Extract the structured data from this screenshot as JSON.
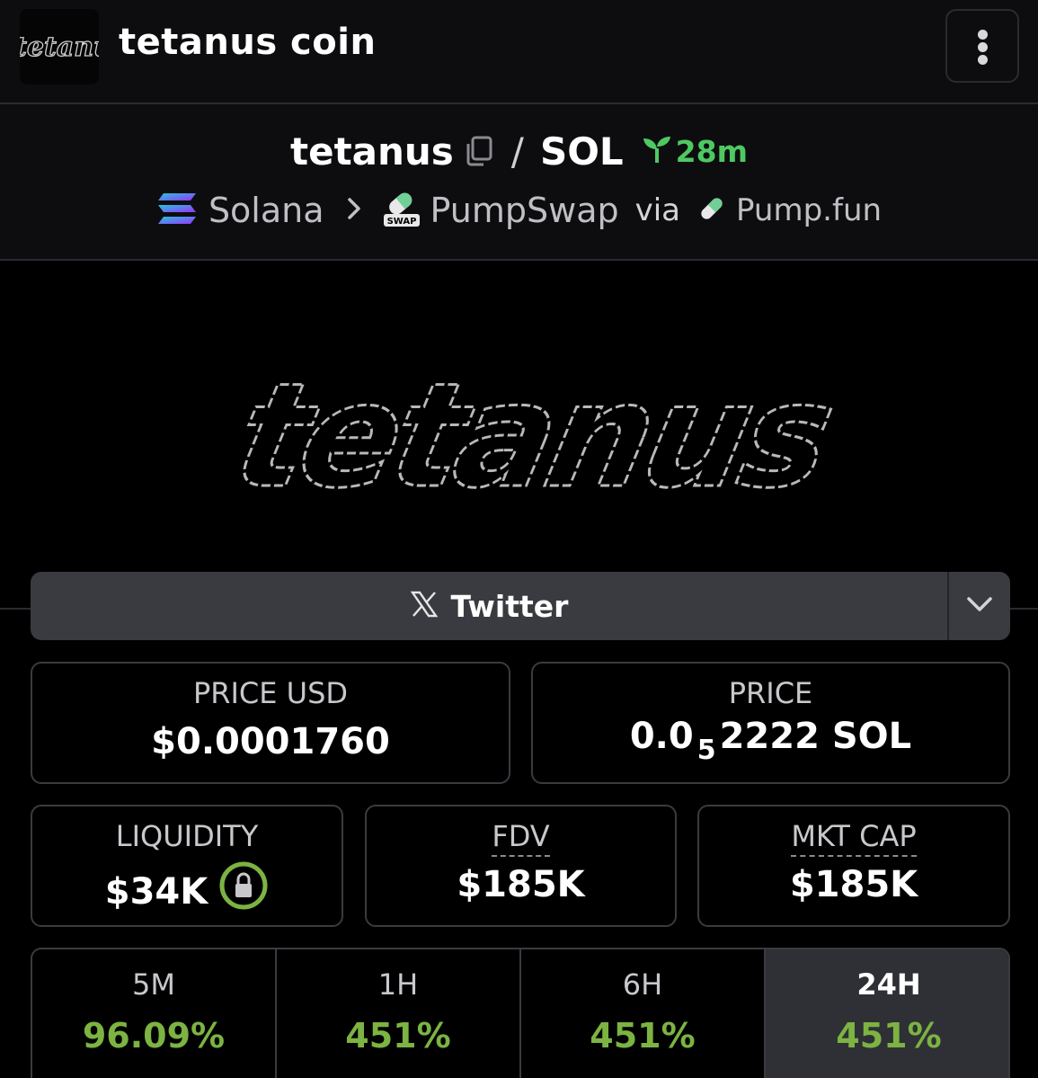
{
  "header": {
    "logo_text": "tetanus",
    "title": "tetanus coin"
  },
  "pair": {
    "base_symbol": "tetanus",
    "separator": "/",
    "quote_symbol": "SOL",
    "age": "28m"
  },
  "route": {
    "chain": "Solana",
    "dex": "PumpSwap",
    "dex_badge": "SWAP",
    "via": "via",
    "launchpad": "Pump.fun"
  },
  "banner": {
    "text": "tetanus"
  },
  "social": {
    "twitter_label": "Twitter"
  },
  "stats": {
    "price_usd": {
      "label": "PRICE USD",
      "value": "$0.0001760"
    },
    "price_native": {
      "label": "PRICE",
      "prefix": "0.0",
      "zeros": "5",
      "suffix": "2222 SOL"
    },
    "liquidity": {
      "label": "LIQUIDITY",
      "value": "$34K"
    },
    "fdv": {
      "label": "FDV",
      "value": "$185K"
    },
    "mkt_cap": {
      "label": "MKT CAP",
      "value": "$185K"
    }
  },
  "changes": [
    {
      "label": "5M",
      "value": "96.09%"
    },
    {
      "label": "1H",
      "value": "451%"
    },
    {
      "label": "6H",
      "value": "451%"
    },
    {
      "label": "24H",
      "value": "451%",
      "active": true
    }
  ],
  "colors": {
    "background": "#000000",
    "header_bg": "#0d0d0f",
    "border": "#3a3b40",
    "positive": "#7cb342",
    "age_green": "#4ec962",
    "locked_ring": "#7cb342"
  },
  "icons": {
    "menu": "more-vertical-icon",
    "copy": "copy-icon",
    "age": "seedling-icon",
    "chain": "solana-icon",
    "dex": "pumpswap-icon",
    "launchpad": "pill-icon",
    "twitter": "x-logo-icon",
    "expand": "chevron-down-icon",
    "lock": "lock-icon"
  }
}
